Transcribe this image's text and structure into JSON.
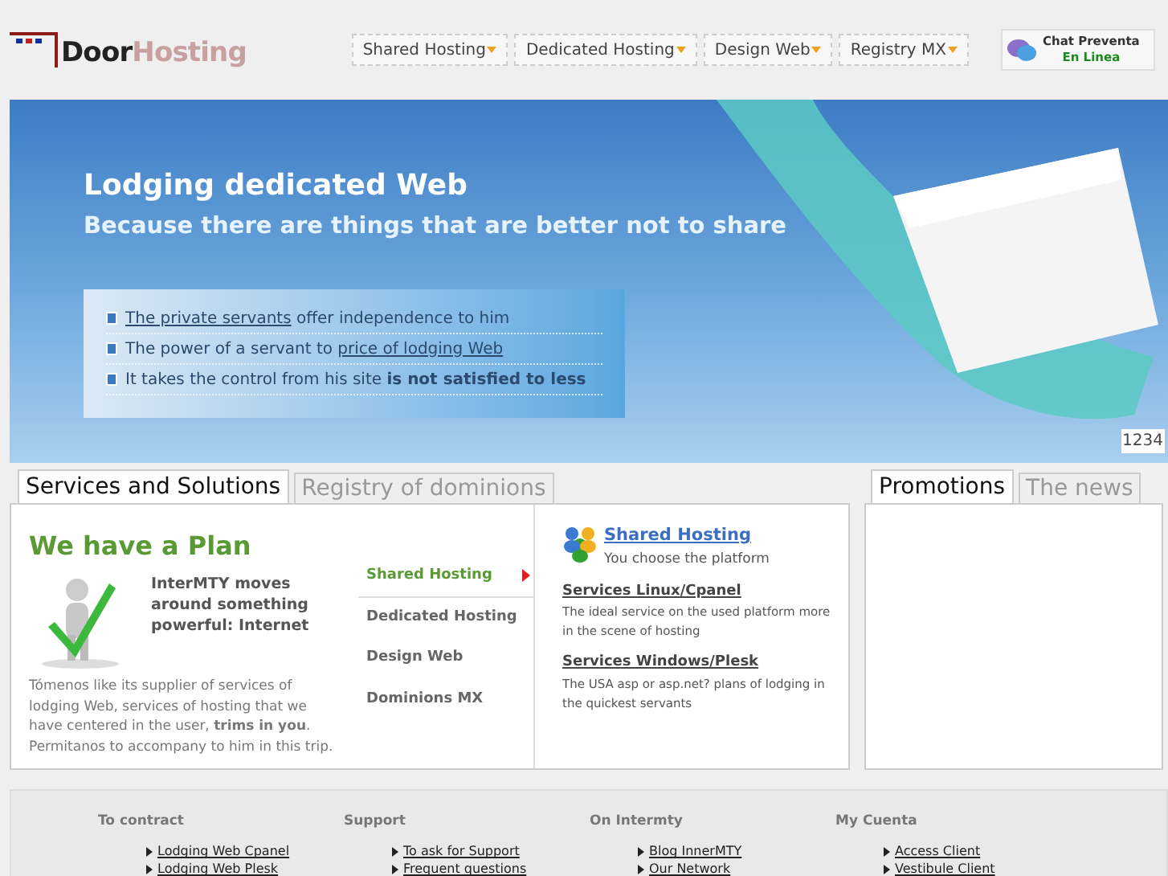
{
  "logo": {
    "part_1": "Door",
    "part_2": "Hosting"
  },
  "nav": [
    {
      "label": "Shared Hosting"
    },
    {
      "label": "Dedicated Hosting"
    },
    {
      "label": "Design Web"
    },
    {
      "label": "Registry MX"
    }
  ],
  "chat": {
    "line_1": "Chat Preventa",
    "line_2": "En Linea"
  },
  "banner": {
    "title": "Lodging dedicated Web",
    "subtitle": "Because there are things that are better not to share",
    "bullets": [
      [
        {
          "kind": "link",
          "text": "The private servants"
        },
        {
          "kind": "text",
          "text": " offer independence to him"
        }
      ],
      [
        {
          "kind": "text",
          "text": "The power of a servant to "
        },
        {
          "kind": "link",
          "text": "price of lodging Web"
        }
      ],
      [
        {
          "kind": "text",
          "text": "It takes the control from his site "
        },
        {
          "kind": "bold",
          "text": "is not satisfied to less"
        }
      ]
    ],
    "pager": "1234"
  },
  "main_tabs": [
    {
      "label": "Services and Solutions",
      "selected": true
    },
    {
      "label": "Registry of dominions",
      "selected": false
    }
  ],
  "plan": {
    "title": "We have a Plan",
    "lead": "InterMTY moves around something powerful: Internet",
    "body": "Tómenos like its supplier of services of lodging Web, services of hosting that we have centered in the user, **trims in you**. Permitanos to accompany to him in this trip."
  },
  "menu": [
    {
      "label": "Shared Hosting",
      "selected": true
    },
    {
      "label": "Dedicated Hosting",
      "selected": false
    },
    {
      "label": "Design Web",
      "selected": false
    },
    {
      "label": "Dominions MX",
      "selected": false
    }
  ],
  "detail": {
    "title": "Shared Hosting",
    "subtitle": "You choose the platform",
    "items": [
      {
        "title": "Services Linux/Cpanel",
        "text": "The ideal service on the used platform more in the scene of hosting"
      },
      {
        "title": "Services Windows/Plesk",
        "text": "The USA asp or asp.net? plans of lodging in the quickest servants"
      }
    ]
  },
  "side_tabs": [
    {
      "label": "Promotions",
      "selected": true
    },
    {
      "label": "The news",
      "selected": false
    }
  ],
  "footer": [
    {
      "title": "To contract",
      "links": [
        "Lodging Web Cpanel",
        "Lodging Web Plesk"
      ]
    },
    {
      "title": "Support",
      "links": [
        "To ask for Support",
        "Frequent questions"
      ]
    },
    {
      "title": "On Intermty",
      "links": [
        "Blog InnerMTY",
        "Our Network"
      ]
    },
    {
      "title": "My Cuenta",
      "links": [
        "Access Client",
        "Vestibule Client"
      ]
    }
  ]
}
